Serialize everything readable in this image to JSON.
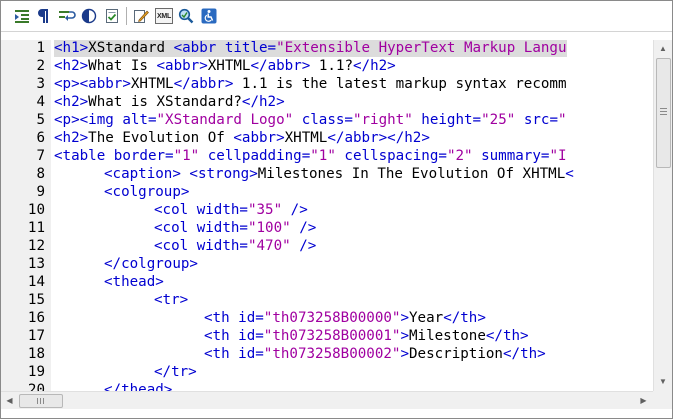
{
  "toolbar": {
    "buttons": [
      {
        "name": "indent-icon"
      },
      {
        "name": "paragraph-icon"
      },
      {
        "name": "word-wrap-icon"
      },
      {
        "name": "contrast-icon"
      },
      {
        "name": "validate-icon"
      },
      {
        "name": "edit-pen-icon"
      },
      {
        "name": "xml-view-icon",
        "label": "XML"
      },
      {
        "name": "find-replace-icon"
      },
      {
        "name": "accessibility-icon"
      }
    ]
  },
  "colors": {
    "tag": "#0000d0",
    "string": "#a000a0",
    "text": "#000000",
    "gutter": "#f0f0f0",
    "selection": "#dcdcdc"
  },
  "editor": {
    "lines": [
      {
        "n": "1",
        "selected": true,
        "indent": 0,
        "tokens": [
          [
            "tag",
            "<h1>"
          ],
          [
            "txt",
            "XStandard "
          ],
          [
            "tag",
            "<abbr title="
          ],
          [
            "str",
            "\"Extensible HyperText Markup Langu"
          ]
        ]
      },
      {
        "n": "2",
        "indent": 0,
        "tokens": [
          [
            "tag",
            "<h2>"
          ],
          [
            "txt",
            "What Is "
          ],
          [
            "tag",
            "<abbr>"
          ],
          [
            "txt",
            "XHTML"
          ],
          [
            "tag",
            "</abbr>"
          ],
          [
            "txt",
            " 1.1?"
          ],
          [
            "tag",
            "</h2>"
          ]
        ]
      },
      {
        "n": "3",
        "indent": 0,
        "tokens": [
          [
            "tag",
            "<p><abbr>"
          ],
          [
            "txt",
            "XHTML"
          ],
          [
            "tag",
            "</abbr>"
          ],
          [
            "txt",
            " 1.1 is the latest markup syntax recomm"
          ]
        ]
      },
      {
        "n": "4",
        "indent": 0,
        "tokens": [
          [
            "tag",
            "<h2>"
          ],
          [
            "txt",
            "What is XStandard?"
          ],
          [
            "tag",
            "</h2>"
          ]
        ]
      },
      {
        "n": "5",
        "indent": 0,
        "tokens": [
          [
            "tag",
            "<p><img alt="
          ],
          [
            "str",
            "\"XStandard Logo\""
          ],
          [
            "tag",
            " class="
          ],
          [
            "str",
            "\"right\""
          ],
          [
            "tag",
            " height="
          ],
          [
            "str",
            "\"25\""
          ],
          [
            "tag",
            " src="
          ],
          [
            "str",
            "\""
          ]
        ]
      },
      {
        "n": "6",
        "indent": 0,
        "tokens": [
          [
            "tag",
            "<h2>"
          ],
          [
            "txt",
            "The Evolution Of "
          ],
          [
            "tag",
            "<abbr>"
          ],
          [
            "txt",
            "XHTML"
          ],
          [
            "tag",
            "</abbr></h2>"
          ]
        ]
      },
      {
        "n": "7",
        "indent": 0,
        "tokens": [
          [
            "tag",
            "<table border="
          ],
          [
            "str",
            "\"1\""
          ],
          [
            "tag",
            " cellpadding="
          ],
          [
            "str",
            "\"1\""
          ],
          [
            "tag",
            " cellspacing="
          ],
          [
            "str",
            "\"2\""
          ],
          [
            "tag",
            " summary="
          ],
          [
            "str",
            "\"I"
          ]
        ]
      },
      {
        "n": "8",
        "indent": 1,
        "tokens": [
          [
            "tag",
            "<caption> <strong>"
          ],
          [
            "txt",
            "Milestones In The Evolution Of XHTML"
          ],
          [
            "tag",
            "<"
          ]
        ]
      },
      {
        "n": "9",
        "indent": 1,
        "tokens": [
          [
            "tag",
            "<colgroup>"
          ]
        ]
      },
      {
        "n": "10",
        "indent": 2,
        "tokens": [
          [
            "tag",
            "<col width="
          ],
          [
            "str",
            "\"35\""
          ],
          [
            "tag",
            " />"
          ]
        ]
      },
      {
        "n": "11",
        "indent": 2,
        "tokens": [
          [
            "tag",
            "<col width="
          ],
          [
            "str",
            "\"100\""
          ],
          [
            "tag",
            " />"
          ]
        ]
      },
      {
        "n": "12",
        "indent": 2,
        "tokens": [
          [
            "tag",
            "<col width="
          ],
          [
            "str",
            "\"470\""
          ],
          [
            "tag",
            " />"
          ]
        ]
      },
      {
        "n": "13",
        "indent": 1,
        "tokens": [
          [
            "tag",
            "</colgroup>"
          ]
        ]
      },
      {
        "n": "14",
        "indent": 1,
        "tokens": [
          [
            "tag",
            "<thead>"
          ]
        ]
      },
      {
        "n": "15",
        "indent": 2,
        "tokens": [
          [
            "tag",
            "<tr>"
          ]
        ]
      },
      {
        "n": "16",
        "indent": 3,
        "tokens": [
          [
            "tag",
            "<th id="
          ],
          [
            "str",
            "\"th073258B00000\""
          ],
          [
            "tag",
            ">"
          ],
          [
            "txt",
            "Year"
          ],
          [
            "tag",
            "</th>"
          ]
        ]
      },
      {
        "n": "17",
        "indent": 3,
        "tokens": [
          [
            "tag",
            "<th id="
          ],
          [
            "str",
            "\"th073258B00001\""
          ],
          [
            "tag",
            ">"
          ],
          [
            "txt",
            "Milestone"
          ],
          [
            "tag",
            "</th>"
          ]
        ]
      },
      {
        "n": "18",
        "indent": 3,
        "tokens": [
          [
            "tag",
            "<th id="
          ],
          [
            "str",
            "\"th073258B00002\""
          ],
          [
            "tag",
            ">"
          ],
          [
            "txt",
            "Description"
          ],
          [
            "tag",
            "</th>"
          ]
        ]
      },
      {
        "n": "19",
        "indent": 2,
        "tokens": [
          [
            "tag",
            "</tr>"
          ]
        ]
      },
      {
        "n": "20",
        "indent": 1,
        "tokens": [
          [
            "tag",
            "</thead>"
          ]
        ]
      }
    ]
  },
  "scrollbars": {
    "vertical": {
      "up_icon": "▲",
      "down_icon": "▼"
    },
    "horizontal": {
      "left_icon": "◀",
      "right_icon": "▶"
    }
  }
}
